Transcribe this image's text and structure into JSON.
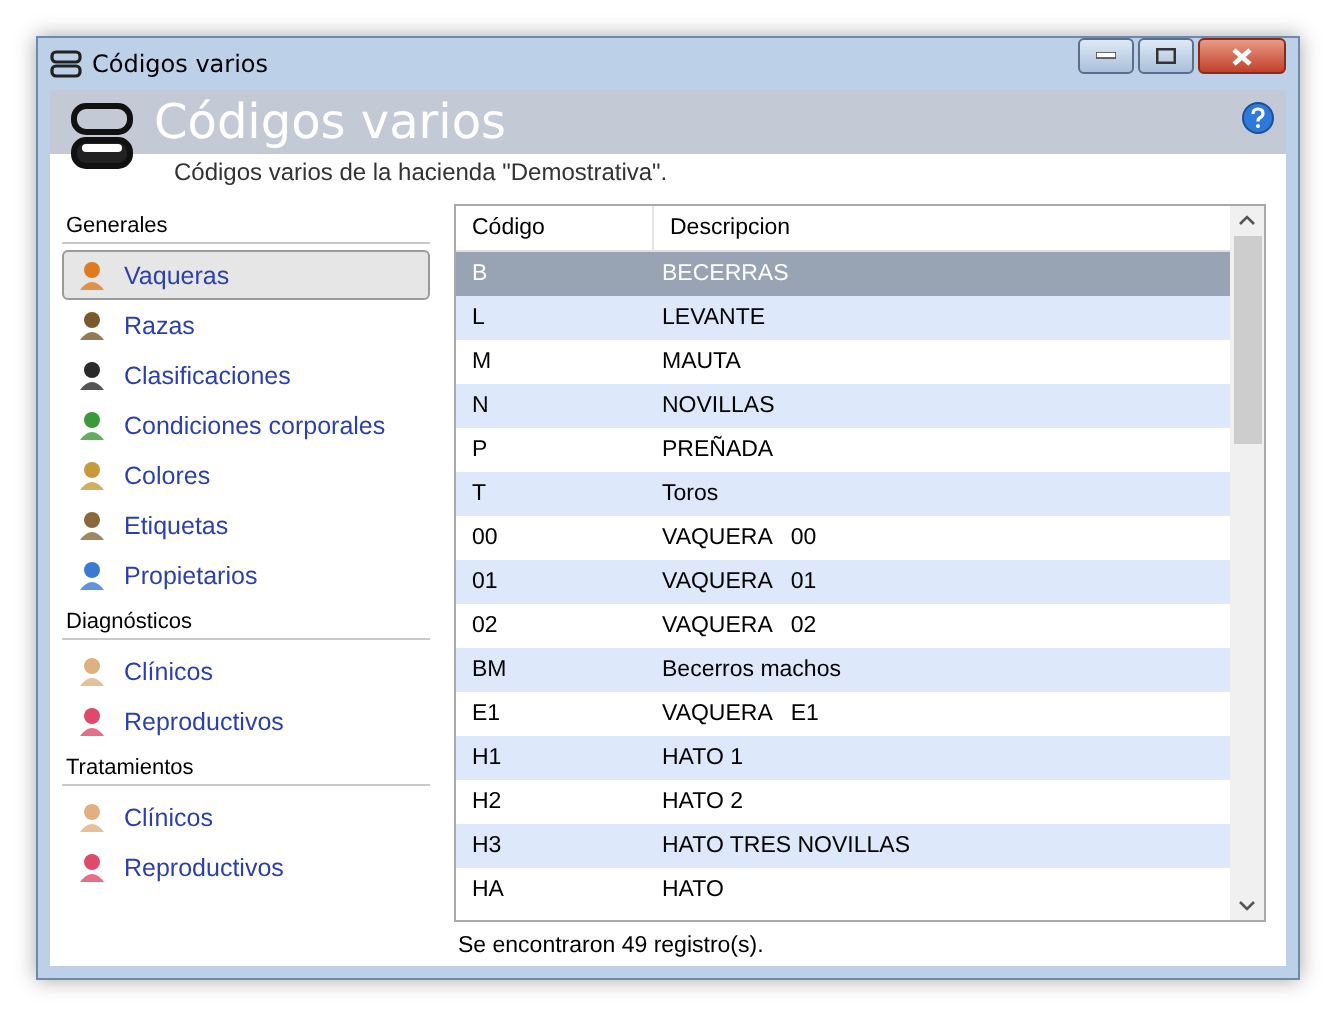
{
  "window": {
    "title": "Códigos varios"
  },
  "header": {
    "title": "Códigos varios",
    "subtitle": "Códigos varios de la hacienda \"Demostrativa\"."
  },
  "sidebar": {
    "sections": [
      {
        "title": "Generales",
        "items": [
          {
            "label": "Vaqueras",
            "selected": true
          },
          {
            "label": "Razas",
            "selected": false
          },
          {
            "label": "Clasificaciones",
            "selected": false
          },
          {
            "label": "Condiciones corporales",
            "selected": false
          },
          {
            "label": "Colores",
            "selected": false
          },
          {
            "label": "Etiquetas",
            "selected": false
          },
          {
            "label": "Propietarios",
            "selected": false
          }
        ]
      },
      {
        "title": "Diagnósticos",
        "items": [
          {
            "label": "Clínicos",
            "selected": false
          },
          {
            "label": "Reproductivos",
            "selected": false
          }
        ]
      },
      {
        "title": "Tratamientos",
        "items": [
          {
            "label": "Clínicos",
            "selected": false
          },
          {
            "label": "Reproductivos",
            "selected": false
          }
        ]
      }
    ]
  },
  "table": {
    "columns": [
      "Código",
      "Descripcion"
    ],
    "rows": [
      {
        "cells": [
          "B",
          "BECERRAS"
        ],
        "selected": true
      },
      {
        "cells": [
          "L",
          "LEVANTE"
        ],
        "selected": false
      },
      {
        "cells": [
          "M",
          "MAUTA"
        ],
        "selected": false
      },
      {
        "cells": [
          "N",
          "NOVILLAS"
        ],
        "selected": false
      },
      {
        "cells": [
          "P",
          "PREÑADA"
        ],
        "selected": false
      },
      {
        "cells": [
          "T",
          "Toros"
        ],
        "selected": false
      },
      {
        "cells": [
          "00",
          "VAQUERA   00"
        ],
        "selected": false
      },
      {
        "cells": [
          "01",
          "VAQUERA   01"
        ],
        "selected": false
      },
      {
        "cells": [
          "02",
          "VAQUERA   02"
        ],
        "selected": false
      },
      {
        "cells": [
          "BM",
          "Becerros machos"
        ],
        "selected": false
      },
      {
        "cells": [
          "E1",
          "VAQUERA   E1"
        ],
        "selected": false
      },
      {
        "cells": [
          "H1",
          "HATO 1"
        ],
        "selected": false
      },
      {
        "cells": [
          "H2",
          "HATO 2"
        ],
        "selected": false
      },
      {
        "cells": [
          "H3",
          "HATO TRES NOVILLAS"
        ],
        "selected": false
      },
      {
        "cells": [
          "HA",
          "HATO"
        ],
        "selected": false
      }
    ]
  },
  "status_bar": {
    "text": "Se encontraron 49 registro(s)."
  }
}
